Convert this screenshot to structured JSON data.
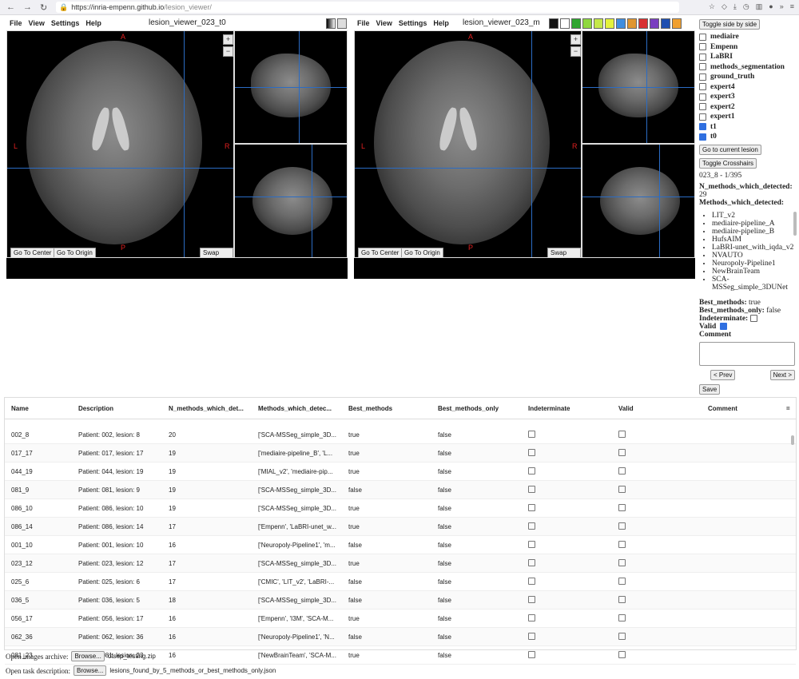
{
  "browser": {
    "url_host": "https://inria-empenn.github.io",
    "url_path": "/lesion_viewer/"
  },
  "left_viewer": {
    "menu": [
      "File",
      "View",
      "Settings",
      "Help"
    ],
    "title": "lesion_viewer_023_t0",
    "orient": {
      "a": "A",
      "l": "L",
      "r": "R",
      "p": "P"
    },
    "zoom_in": "+",
    "zoom_out": "−",
    "go_center": "Go To Center",
    "go_origin": "Go To Origin",
    "swap_view": "Swap View"
  },
  "right_viewer": {
    "menu": [
      "File",
      "View",
      "Settings",
      "Help"
    ],
    "title": "lesion_viewer_023_m",
    "orient": {
      "a": "A",
      "l": "L",
      "r": "R",
      "p": "P"
    },
    "zoom_in": "+",
    "zoom_out": "−",
    "go_center": "Go To Center",
    "go_origin": "Go To Origin",
    "swap_view": "Swap View",
    "colormaps": [
      "#111111",
      "#ffffff",
      "#2fa52f",
      "#8fd83f",
      "#c5e84a",
      "#e4f23c",
      "#3f8ee0",
      "#e0962f",
      "#d83030",
      "#7a3fc0",
      "#1f4fb0",
      "#f0a030"
    ]
  },
  "panel": {
    "toggle_side": "Toggle side by side",
    "layers": [
      {
        "label": "mediaire",
        "checked": false
      },
      {
        "label": "Empenn",
        "checked": false
      },
      {
        "label": "LaBRI",
        "checked": false
      },
      {
        "label": "methods_segmentation",
        "checked": false
      },
      {
        "label": "ground_truth",
        "checked": false
      },
      {
        "label": "expert4",
        "checked": false
      },
      {
        "label": "expert3",
        "checked": false
      },
      {
        "label": "expert2",
        "checked": false
      },
      {
        "label": "expert1",
        "checked": false
      },
      {
        "label": "t1",
        "checked": true
      },
      {
        "label": "t0",
        "checked": true
      }
    ],
    "go_current": "Go to current lesion",
    "toggle_cross": "Toggle Crosshairs",
    "lesion_index": "023_8 - 1/395",
    "n_methods_label": "N_methods_which_detected:",
    "n_methods_value": "29",
    "methods_label": "Methods_which_detected:",
    "methods": [
      "LIT_v2",
      "mediaire-pipeline_A",
      "mediaire-pipeline_B",
      "HufsAIM",
      "LaBRI-unet_with_iqda_v2",
      "NVAUTO",
      "Neuropoly-Pipeline1",
      "NewBrainTeam",
      "SCA-MSSeg_simple_3DUNet"
    ],
    "best_label": "Best_methods:",
    "best_value": "true",
    "best_only_label": "Best_methods_only:",
    "best_only_value": "false",
    "indeterminate_label": "Indeterminate:",
    "valid_label": "Valid",
    "comment_label": "Comment",
    "prev": "< Prev",
    "next": "Next >",
    "save": "Save"
  },
  "table": {
    "columns": [
      "Name",
      "Description",
      "N_methods_which_det...",
      "Methods_which_detec...",
      "Best_methods",
      "Best_methods_only",
      "Indeterminate",
      "Valid",
      "Comment"
    ],
    "menu_icon": "=",
    "rows": [
      [
        "002_8",
        "Patient: 002, lesion: 8",
        "20",
        "['SCA-MSSeg_simple_3D...",
        "true",
        "false"
      ],
      [
        "017_17",
        "Patient: 017, lesion: 17",
        "19",
        "['mediaire-pipeline_B', 'L...",
        "true",
        "false"
      ],
      [
        "044_19",
        "Patient: 044, lesion: 19",
        "19",
        "['MIAL_v2', 'mediaire-pip...",
        "true",
        "false"
      ],
      [
        "081_9",
        "Patient: 081, lesion: 9",
        "19",
        "['SCA-MSSeg_simple_3D...",
        "false",
        "false"
      ],
      [
        "086_10",
        "Patient: 086, lesion: 10",
        "19",
        "['SCA-MSSeg_simple_3D...",
        "true",
        "false"
      ],
      [
        "086_14",
        "Patient: 086, lesion: 14",
        "17",
        "['Empenn', 'LaBRI-unet_w...",
        "true",
        "false"
      ],
      [
        "001_10",
        "Patient: 001, lesion: 10",
        "16",
        "['Neuropoly-Pipeline1', 'm...",
        "false",
        "false"
      ],
      [
        "023_12",
        "Patient: 023, lesion: 12",
        "17",
        "['SCA-MSSeg_simple_3D...",
        "true",
        "false"
      ],
      [
        "025_6",
        "Patient: 025, lesion: 6",
        "17",
        "['CMIC', 'LIT_v2', 'LaBRI-...",
        "false",
        "false"
      ],
      [
        "036_5",
        "Patient: 036, lesion: 5",
        "18",
        "['SCA-MSSeg_simple_3D...",
        "false",
        "false"
      ],
      [
        "056_17",
        "Patient: 056, lesion: 17",
        "16",
        "['Empenn', 'I3M', 'SCA-M...",
        "true",
        "false"
      ],
      [
        "062_36",
        "Patient: 062, lesion: 36",
        "16",
        "['Neuropoly-Pipeline1', 'N...",
        "false",
        "false"
      ],
      [
        "081_23",
        "Patient: 081, lesion: 23",
        "16",
        "['NewBrainTeam', 'SCA-M...",
        "true",
        "false"
      ]
    ]
  },
  "footer": {
    "archive_label": "Open images archive:",
    "archive_browse": "Browse...",
    "archive_file": "ofsep_testing.zip",
    "task_label": "Open task description:",
    "task_browse": "Browse...",
    "task_file": "lesions_found_by_5_methods_or_best_methods_only.json"
  }
}
